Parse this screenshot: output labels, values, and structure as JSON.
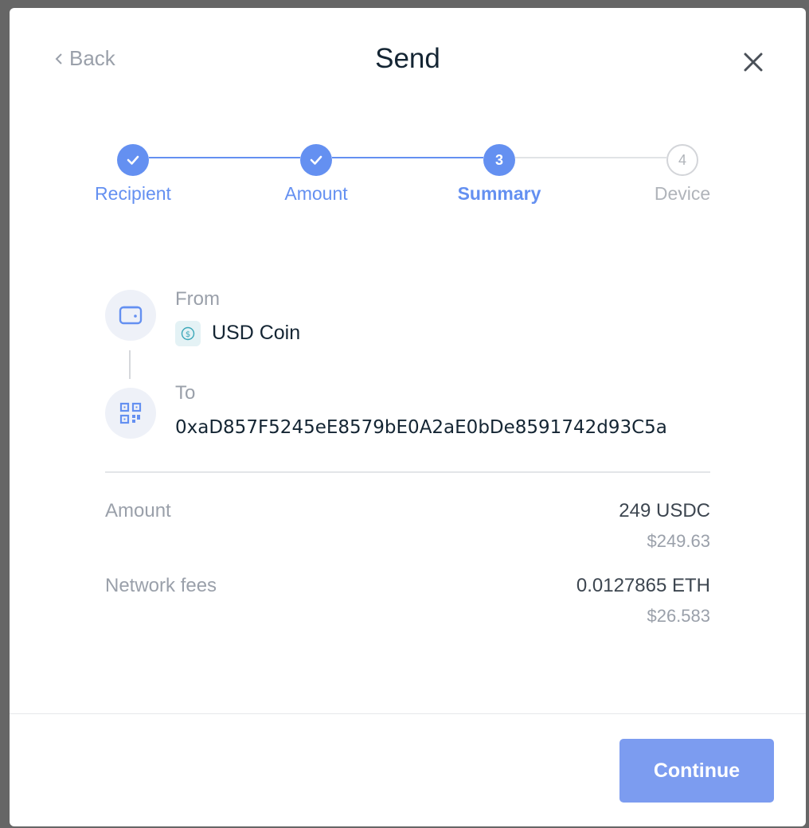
{
  "header": {
    "back_label": "Back",
    "title": "Send",
    "close_icon": "close-icon"
  },
  "stepper": {
    "steps": [
      {
        "label": "Recipient",
        "state": "done",
        "marker": "check-icon"
      },
      {
        "label": "Amount",
        "state": "done",
        "marker": "check-icon"
      },
      {
        "label": "Summary",
        "state": "active",
        "number": "3"
      },
      {
        "label": "Device",
        "state": "todo",
        "number": "4"
      }
    ]
  },
  "summary": {
    "from_label": "From",
    "from_value": "USD Coin",
    "from_icon": "wallet-icon",
    "coin_icon": "usd-coin-icon",
    "to_label": "To",
    "to_value": "0xaD857F5245eE8579bE0A2aE0bDe8591742d93C5a",
    "to_icon": "qr-code-icon"
  },
  "details": {
    "amount_label": "Amount",
    "amount_value": "249 USDC",
    "amount_fiat": "$249.63",
    "fees_label": "Network fees",
    "fees_value": "0.0127865 ETH",
    "fees_fiat": "$26.583"
  },
  "footer": {
    "continue_label": "Continue"
  },
  "colors": {
    "accent": "#6490f1",
    "button": "#7c9cf0",
    "muted": "#9aa0aa",
    "text": "#142533"
  }
}
